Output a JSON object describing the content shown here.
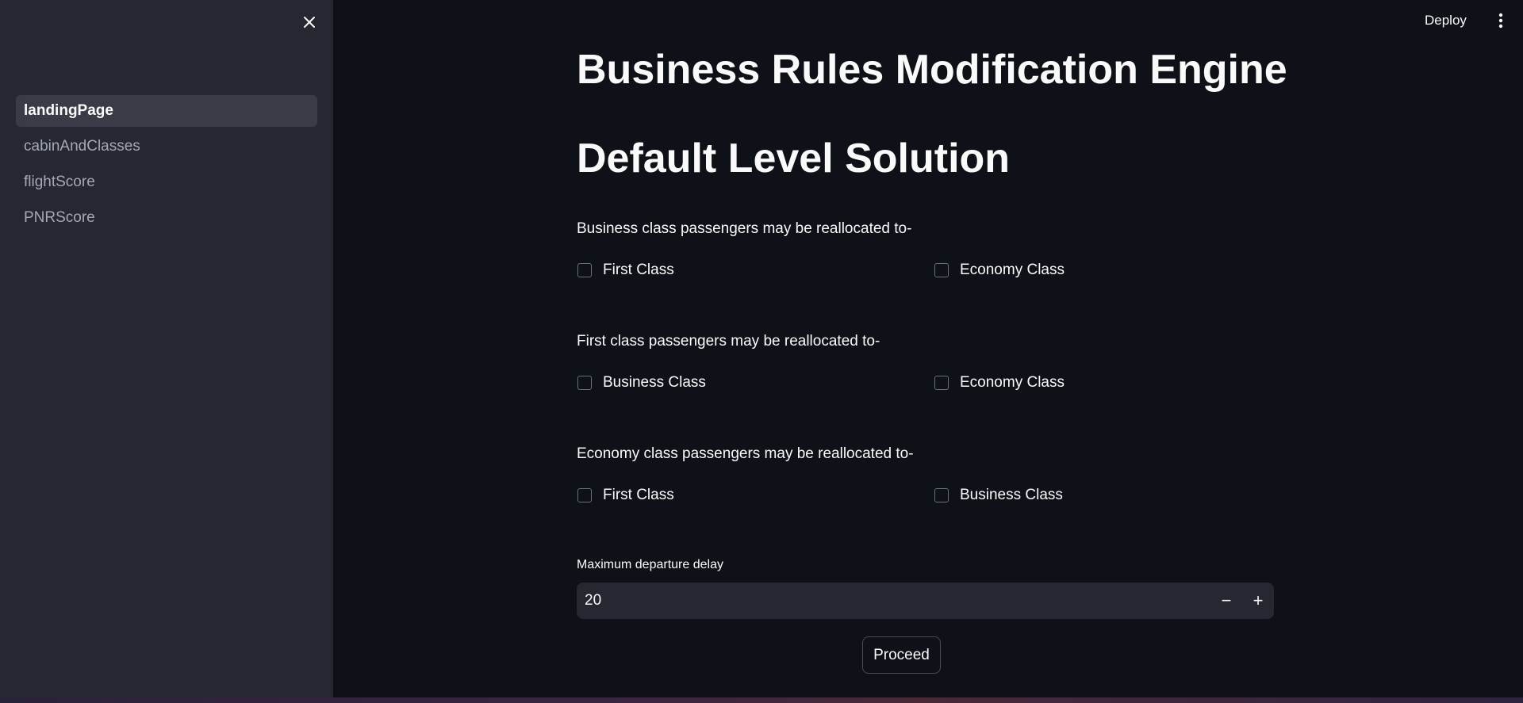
{
  "sidebar": {
    "close_icon": "close-icon",
    "items": [
      {
        "label": "landingPage",
        "active": true
      },
      {
        "label": "cabinAndClasses",
        "active": false
      },
      {
        "label": "flightScore",
        "active": false
      },
      {
        "label": "PNRScore",
        "active": false
      }
    ]
  },
  "header": {
    "deploy_label": "Deploy",
    "menu_icon": "vertical-dots-icon"
  },
  "main": {
    "title": "Business Rules Modification Engine",
    "subtitle": "Default Level Solution",
    "groups": [
      {
        "question": "Business class passengers may be reallocated to-",
        "options": [
          {
            "label": "First Class",
            "checked": false
          },
          {
            "label": "Economy Class",
            "checked": false
          }
        ]
      },
      {
        "question": "First class passengers may be reallocated to-",
        "options": [
          {
            "label": "Business Class",
            "checked": false
          },
          {
            "label": "Economy Class",
            "checked": false
          }
        ]
      },
      {
        "question": "Economy class passengers may be reallocated to-",
        "options": [
          {
            "label": "First Class",
            "checked": false
          },
          {
            "label": "Business Class",
            "checked": false
          }
        ]
      }
    ],
    "delay": {
      "label": "Maximum departure delay",
      "value": "20",
      "minus": "−",
      "plus": "+"
    },
    "proceed_label": "Proceed"
  },
  "colors": {
    "background": "#0e1117",
    "sidebar": "#262730",
    "active_nav": "#3a3b46",
    "text": "#fafafa"
  }
}
